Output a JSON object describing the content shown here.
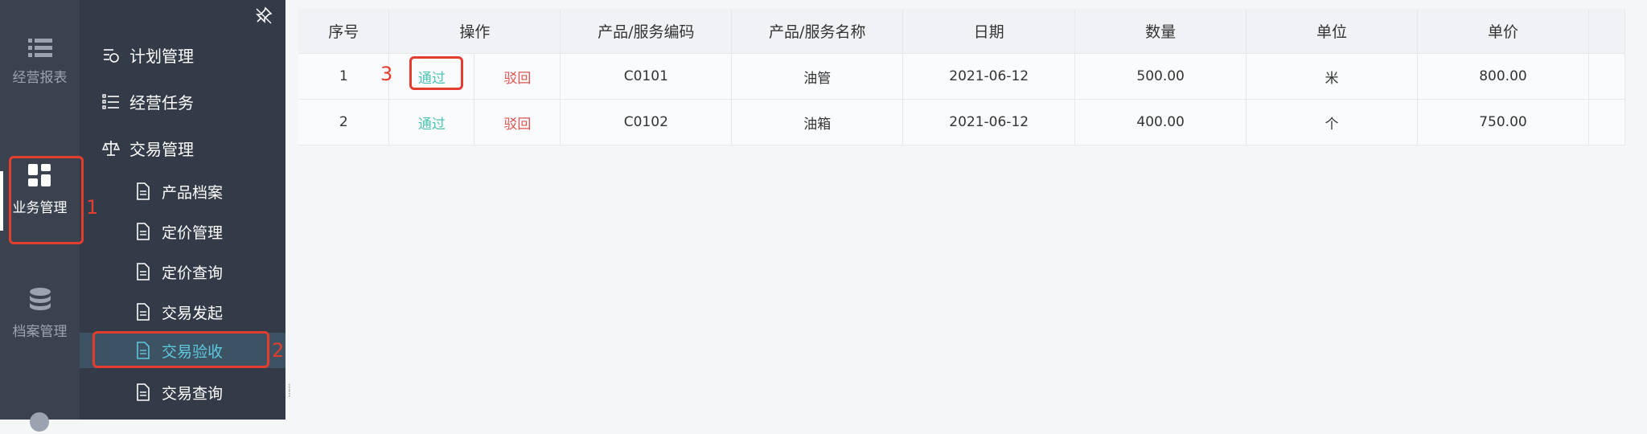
{
  "rail": {
    "items": [
      {
        "label": "经营报表",
        "icon": "list-icon"
      },
      {
        "label": "业务管理",
        "icon": "dashboard-icon"
      },
      {
        "label": "档案管理",
        "icon": "database-icon"
      }
    ]
  },
  "menu": {
    "items": [
      {
        "label": "计划管理",
        "icon": "plan-icon"
      },
      {
        "label": "经营任务",
        "icon": "task-list-icon"
      },
      {
        "label": "交易管理",
        "icon": "scale-icon"
      }
    ],
    "subitems": [
      {
        "label": "产品档案"
      },
      {
        "label": "定价管理"
      },
      {
        "label": "定价查询"
      },
      {
        "label": "交易发起"
      },
      {
        "label": "交易验收"
      },
      {
        "label": "交易查询"
      }
    ],
    "selected": "交易验收"
  },
  "table": {
    "columns": [
      "序号",
      "操作",
      "产品/服务编码",
      "产品/服务名称",
      "日期",
      "数量",
      "单位",
      "单价"
    ],
    "rows": [
      {
        "index": "1",
        "pass": "通过",
        "reject": "驳回",
        "code": "C0101",
        "name": "油管",
        "date": "2021-06-12",
        "qty": "500.00",
        "unit": "米",
        "price": "800.00"
      },
      {
        "index": "2",
        "pass": "通过",
        "reject": "驳回",
        "code": "C0102",
        "name": "油箱",
        "date": "2021-06-12",
        "qty": "400.00",
        "unit": "个",
        "price": "750.00"
      }
    ]
  },
  "annotations": {
    "n1": "1",
    "n2": "2",
    "n3": "3"
  },
  "colors": {
    "accent": "#5ec8df",
    "pass": "#4fc3b4",
    "reject": "#e0524f",
    "annotation": "#e43d30"
  }
}
